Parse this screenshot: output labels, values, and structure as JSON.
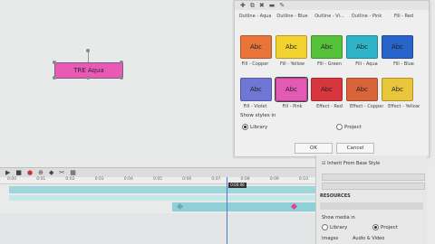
{
  "canvas": {
    "object_text": "TRE Aqua"
  },
  "styles_panel": {
    "toolbar_icons": [
      "plus-icon",
      "copy-icon",
      "delete-icon",
      "minus-icon",
      "edit-icon"
    ],
    "top_row_labels": [
      "Outline - Aqua",
      "Outline - Blue",
      "Outline - Vi...",
      "Outline - Pink",
      "Fill - Red"
    ],
    "row1": [
      {
        "text": "Abc",
        "label": "Fill - Copper",
        "color": "#e8743a"
      },
      {
        "text": "Abc",
        "label": "Fill - Yellow",
        "color": "#f2d22e"
      },
      {
        "text": "Abc",
        "label": "Fill - Green",
        "color": "#56c23b"
      },
      {
        "text": "Abc",
        "label": "Fill - Aqua",
        "color": "#2fb3c9"
      },
      {
        "text": "Abc",
        "label": "Fill - Blue",
        "color": "#2763c9"
      }
    ],
    "row2": [
      {
        "text": "Abc",
        "label": "Fill - Violet",
        "color": "#6f76d6"
      },
      {
        "text": "Abc",
        "label": "Fill - Pink",
        "color": "#e25ab4"
      },
      {
        "text": "Abc",
        "label": "Effect - Red",
        "color": "#d8363e"
      },
      {
        "text": "Abc",
        "label": "Effect - Copper",
        "color": "#d9643a"
      },
      {
        "text": "Abc",
        "label": "Effect - Yellow",
        "color": "#e9c53a"
      }
    ],
    "show_styles_label": "Show styles in",
    "radio_library": "Library",
    "radio_project": "Project",
    "ok": "OK",
    "cancel": "Cancel"
  },
  "right_panel": {
    "inherit": "Inherit From Base Style",
    "resources": "RESOURCES",
    "show_media_in": "Show media in",
    "library": "Library",
    "project": "Project",
    "images": "Images",
    "audio_video": "Audio & Video"
  },
  "timeline": {
    "toolbar_icons": [
      "play-icon",
      "stop-icon",
      "record-icon",
      "zoom-icon",
      "marker-icon"
    ],
    "ruler": [
      "0:00",
      "0:01",
      "0:02",
      "0:03",
      "0:04",
      "0:05",
      "0:06",
      "0:07",
      "0:08",
      "0:09",
      "0:10"
    ],
    "playhead_label": "0:00:06"
  },
  "colors": {
    "accent": "#e85ab4",
    "track": "#8fd0d6",
    "track_light": "#bfe3e6",
    "playhead": "#4a7fc0",
    "keyframe": "#e0409a"
  }
}
